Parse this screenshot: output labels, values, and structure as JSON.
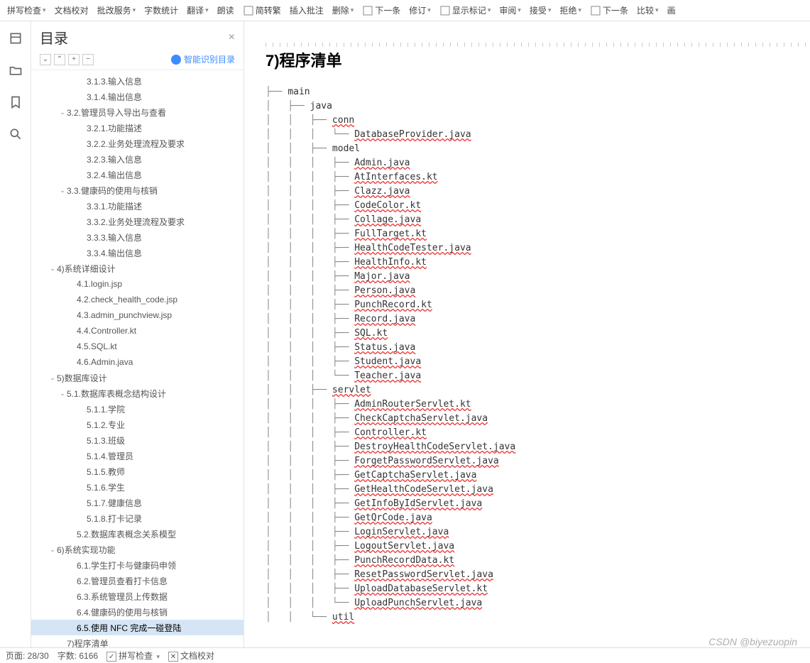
{
  "toolbar": [
    {
      "label": "拼写检查",
      "dd": true
    },
    {
      "label": "文档校对"
    },
    {
      "label": "批改服务",
      "dd": true
    },
    {
      "label": "字数统计"
    },
    {
      "label": "翻译",
      "dd": true
    },
    {
      "label": "朗读"
    },
    {
      "label": "简转繁",
      "icon": "convert-icon"
    },
    {
      "label": "插入批注"
    },
    {
      "label": "删除",
      "dd": true
    },
    {
      "label": "下一条",
      "icon": "next-comment-icon"
    },
    {
      "label": "修订",
      "dd": true
    },
    {
      "label": "显示标记",
      "icon": "show-marks-icon",
      "dd": true
    },
    {
      "label": "审阅",
      "dd": true
    },
    {
      "label": "接受",
      "dd": true
    },
    {
      "label": "拒绝",
      "dd": true
    },
    {
      "label": "下一条",
      "icon": "next-change-icon"
    },
    {
      "label": "比较",
      "dd": true
    },
    {
      "label": "画"
    }
  ],
  "outline": {
    "title": "目录",
    "smart": "智能识别目录",
    "items": [
      {
        "ind": 4,
        "chev": "",
        "txt": "3.1.3.输入信息"
      },
      {
        "ind": 4,
        "chev": "",
        "txt": "3.1.4.输出信息"
      },
      {
        "ind": 2,
        "chev": "v",
        "txt": "3.2.管理员导入导出与查看"
      },
      {
        "ind": 4,
        "chev": "",
        "txt": "3.2.1.功能描述"
      },
      {
        "ind": 4,
        "chev": "",
        "txt": "3.2.2.业务处理流程及要求"
      },
      {
        "ind": 4,
        "chev": "",
        "txt": "3.2.3.输入信息"
      },
      {
        "ind": 4,
        "chev": "",
        "txt": "3.2.4.输出信息"
      },
      {
        "ind": 2,
        "chev": "v",
        "txt": "3.3.健康码的使用与核销"
      },
      {
        "ind": 4,
        "chev": "",
        "txt": "3.3.1.功能描述"
      },
      {
        "ind": 4,
        "chev": "",
        "txt": "3.3.2.业务处理流程及要求"
      },
      {
        "ind": 4,
        "chev": "",
        "txt": "3.3.3.输入信息"
      },
      {
        "ind": 4,
        "chev": "",
        "txt": "3.3.4.输出信息"
      },
      {
        "ind": 1,
        "chev": "v",
        "txt": "4)系统详细设计"
      },
      {
        "ind": 3,
        "chev": "",
        "txt": "4.1.login.jsp"
      },
      {
        "ind": 3,
        "chev": "",
        "txt": "4.2.check_health_code.jsp"
      },
      {
        "ind": 3,
        "chev": "",
        "txt": "4.3.admin_punchview.jsp"
      },
      {
        "ind": 3,
        "chev": "",
        "txt": "4.4.Controller.kt"
      },
      {
        "ind": 3,
        "chev": "",
        "txt": "4.5.SQL.kt"
      },
      {
        "ind": 3,
        "chev": "",
        "txt": "4.6.Admin.java"
      },
      {
        "ind": 1,
        "chev": "v",
        "txt": "5)数据库设计"
      },
      {
        "ind": 2,
        "chev": "v",
        "txt": "5.1.数据库表概念结构设计"
      },
      {
        "ind": 4,
        "chev": "",
        "txt": "5.1.1.学院"
      },
      {
        "ind": 4,
        "chev": "",
        "txt": "5.1.2.专业"
      },
      {
        "ind": 4,
        "chev": "",
        "txt": "5.1.3.班级"
      },
      {
        "ind": 4,
        "chev": "",
        "txt": "5.1.4.管理员"
      },
      {
        "ind": 4,
        "chev": "",
        "txt": "5.1.5.教师"
      },
      {
        "ind": 4,
        "chev": "",
        "txt": "5.1.6.学生"
      },
      {
        "ind": 4,
        "chev": "",
        "txt": "5.1.7.健康信息"
      },
      {
        "ind": 4,
        "chev": "",
        "txt": "5.1.8.打卡记录"
      },
      {
        "ind": 3,
        "chev": "",
        "txt": "5.2.数据库表概念关系模型"
      },
      {
        "ind": 1,
        "chev": "v",
        "txt": "6)系统实现功能"
      },
      {
        "ind": 3,
        "chev": "",
        "txt": "6.1.学生打卡与健康码申领"
      },
      {
        "ind": 3,
        "chev": "",
        "txt": "6.2.管理员查看打卡信息"
      },
      {
        "ind": 3,
        "chev": "",
        "txt": "6.3.系统管理员上传数据"
      },
      {
        "ind": 3,
        "chev": "",
        "txt": "6.4.健康码的使用与核销"
      },
      {
        "ind": 3,
        "chev": "",
        "txt": "6.5.使用 NFC 完成一碰登陆",
        "sel": true
      },
      {
        "ind": 2,
        "chev": "",
        "txt": "7)程序清单"
      }
    ]
  },
  "doc": {
    "title": "7)程序清单",
    "tree": [
      {
        "d": 0,
        "t": "├── main",
        "u": false
      },
      {
        "d": 1,
        "t": "├── java",
        "u": false
      },
      {
        "d": 2,
        "t": "├── conn",
        "u": true
      },
      {
        "d": 3,
        "t": "└── DatabaseProvider.java",
        "u": true
      },
      {
        "d": 2,
        "t": "├── model",
        "u": false
      },
      {
        "d": 3,
        "t": "├── Admin.java",
        "u": true
      },
      {
        "d": 3,
        "t": "├── AtInterfaces.kt",
        "u": true
      },
      {
        "d": 3,
        "t": "├── Clazz.java",
        "u": true
      },
      {
        "d": 3,
        "t": "├── CodeColor.kt",
        "u": true
      },
      {
        "d": 3,
        "t": "├── Collage.java",
        "u": true
      },
      {
        "d": 3,
        "t": "├── FullTarget.kt",
        "u": true
      },
      {
        "d": 3,
        "t": "├── HealthCodeTester.java",
        "u": true
      },
      {
        "d": 3,
        "t": "├── HealthInfo.kt",
        "u": true
      },
      {
        "d": 3,
        "t": "├── Major.java",
        "u": true
      },
      {
        "d": 3,
        "t": "├── Person.java",
        "u": true
      },
      {
        "d": 3,
        "t": "├── PunchRecord.kt",
        "u": true
      },
      {
        "d": 3,
        "t": "├── Record.java",
        "u": true
      },
      {
        "d": 3,
        "t": "├── SQL.kt",
        "u": true
      },
      {
        "d": 3,
        "t": "├── Status.java",
        "u": true
      },
      {
        "d": 3,
        "t": "├── Student.java",
        "u": true
      },
      {
        "d": 3,
        "t": "└── Teacher.java",
        "u": true
      },
      {
        "d": 2,
        "t": "├── servlet",
        "u": true
      },
      {
        "d": 3,
        "t": "├── AdminRouterServlet.kt",
        "u": true
      },
      {
        "d": 3,
        "t": "├── CheckCaptchaServlet.java",
        "u": true
      },
      {
        "d": 3,
        "t": "├── Controller.kt",
        "u": true
      },
      {
        "d": 3,
        "t": "├── DestroyHealthCodeServlet.java",
        "u": true
      },
      {
        "d": 3,
        "t": "├── ForgetPasswordServlet.java",
        "u": true
      },
      {
        "d": 3,
        "t": "├── GetCaptchaServlet.java",
        "u": true
      },
      {
        "d": 3,
        "t": "├── GetHealthCodeServlet.java",
        "u": true
      },
      {
        "d": 3,
        "t": "├── GetInfoByIdServlet.java",
        "u": true
      },
      {
        "d": 3,
        "t": "├── GetQrCode.java",
        "u": true
      },
      {
        "d": 3,
        "t": "├── LoginServlet.java",
        "u": true
      },
      {
        "d": 3,
        "t": "├── LogoutServlet.java",
        "u": true
      },
      {
        "d": 3,
        "t": "├── PunchRecordData.kt",
        "u": true
      },
      {
        "d": 3,
        "t": "├── ResetPasswordServlet.java",
        "u": true
      },
      {
        "d": 3,
        "t": "├── UploadDatabaseServlet.kt",
        "u": true
      },
      {
        "d": 3,
        "t": "└── UploadPunchServlet.java",
        "u": true
      },
      {
        "d": 2,
        "t": "└── util",
        "u": true
      }
    ]
  },
  "status": {
    "page": "页面: 28/30",
    "words": "字数: 6166",
    "spell": "拼写检查",
    "proof": "文档校对"
  },
  "watermark": "CSDN @biyezuopin"
}
